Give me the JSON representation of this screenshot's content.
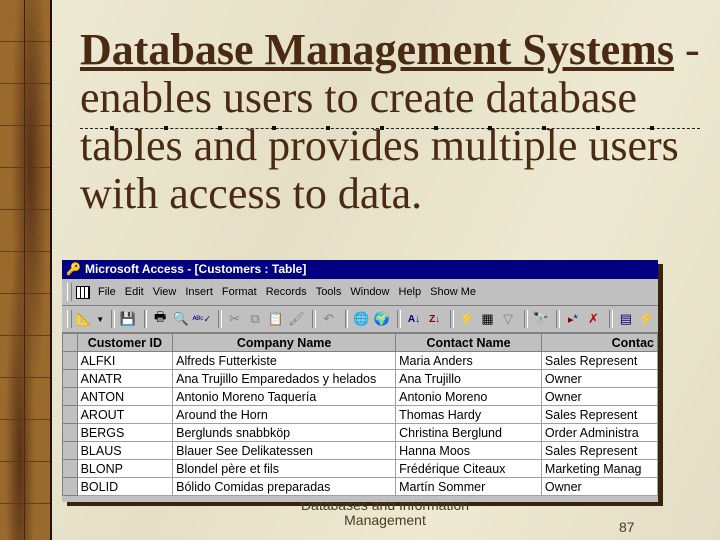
{
  "slide": {
    "heading_term": "Database Management Systems",
    "heading_rest": " - enables users to create database tables and provides multiple users with access to data.",
    "footer_line1": "Databases and Information",
    "footer_line2": "Management",
    "page_number": "87"
  },
  "window": {
    "title": "Microsoft Access - [Customers : Table]",
    "menu": [
      "File",
      "Edit",
      "View",
      "Insert",
      "Format",
      "Records",
      "Tools",
      "Window",
      "Help",
      "Show Me"
    ],
    "toolbar_icons": [
      "design-view",
      "dropdown",
      "save",
      "print",
      "print-preview",
      "spelling",
      "cut",
      "copy",
      "paste",
      "format-painter",
      "undo",
      "insert-hyperlink",
      "web-toolbar",
      "sort-ascending",
      "sort-descending",
      "filter-by-selection",
      "filter-by-form",
      "apply-filter",
      "find",
      "new-record",
      "delete-record",
      "database-window",
      "new-object"
    ]
  },
  "table": {
    "columns": [
      "Customer ID",
      "Company Name",
      "Contact Name",
      "Contac"
    ],
    "rows": [
      [
        "ALFKI",
        "Alfreds Futterkiste",
        "Maria Anders",
        "Sales Represent"
      ],
      [
        "ANATR",
        "Ana Trujillo Emparedados y helados",
        "Ana Trujillo",
        "Owner"
      ],
      [
        "ANTON",
        "Antonio Moreno Taquería",
        "Antonio Moreno",
        "Owner"
      ],
      [
        "AROUT",
        "Around the Horn",
        "Thomas Hardy",
        "Sales Represent"
      ],
      [
        "BERGS",
        "Berglunds snabbköp",
        "Christina Berglund",
        "Order Administra"
      ],
      [
        "BLAUS",
        "Blauer See Delikatessen",
        "Hanna Moos",
        "Sales Represent"
      ],
      [
        "BLONP",
        "Blondel père et fils",
        "Frédérique Citeaux",
        "Marketing Manag"
      ],
      [
        "BOLID",
        "Bólido Comidas preparadas",
        "Martín Sommer",
        "Owner"
      ]
    ]
  }
}
